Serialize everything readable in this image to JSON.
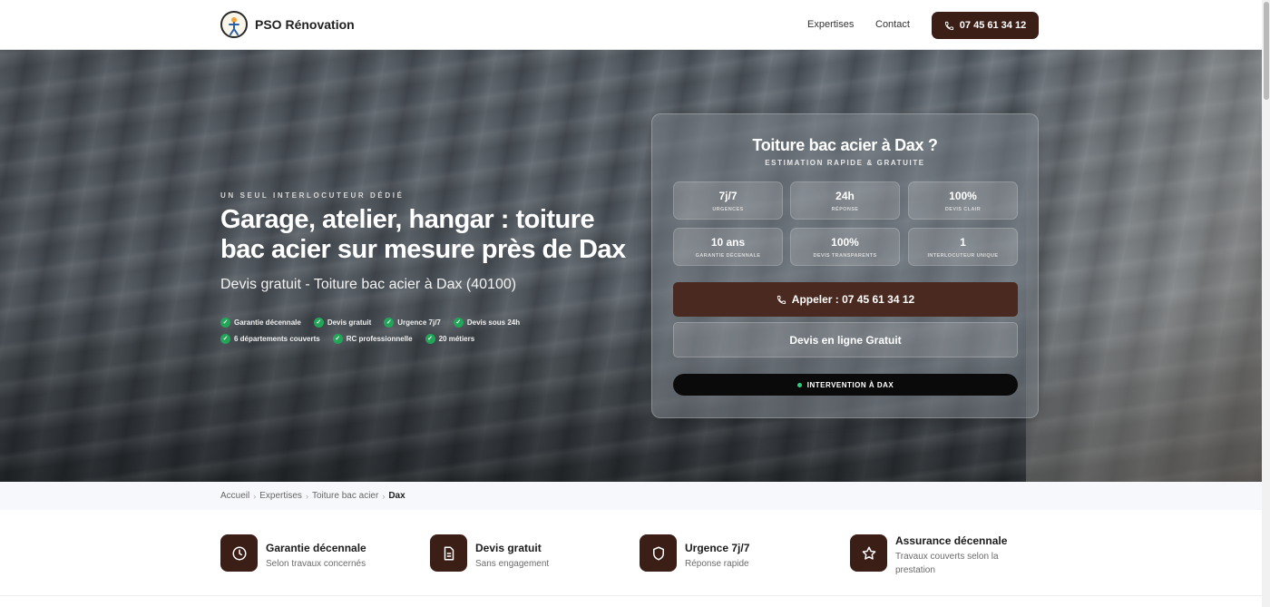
{
  "header": {
    "brand": "PSO Rénovation",
    "nav": [
      "Expertises",
      "Contact"
    ],
    "phone": "07 45 61 34 12"
  },
  "hero": {
    "eyebrow": "UN SEUL INTERLOCUTEUR DÉDIÉ",
    "title": "Garage, atelier, hangar : toiture bac acier sur mesure près de Dax",
    "subtitle": "Devis gratuit - Toiture bac acier à Dax (40100)",
    "chips_row1": [
      "Garantie décennale",
      "Devis gratuit",
      "Urgence 7j/7",
      "Devis sous 24h"
    ],
    "chips_row2": [
      "6 départements couverts",
      "RC professionnelle",
      "20 métiers"
    ]
  },
  "card": {
    "title": "Toiture bac acier à Dax ?",
    "subtitle": "ESTIMATION RAPIDE & GRATUITE",
    "stats": [
      {
        "value": "7j/7",
        "label": "URGENCES"
      },
      {
        "value": "24h",
        "label": "RÉPONSE"
      },
      {
        "value": "100%",
        "label": "DEVIS CLAIR"
      },
      {
        "value": "10 ans",
        "label": "GARANTIE DÉCENNALE"
      },
      {
        "value": "100%",
        "label": "DEVIS TRANSPARENTS"
      },
      {
        "value": "1",
        "label": "INTERLOCUTEUR UNIQUE"
      }
    ],
    "call_label": "Appeler : 07 45 61 34 12",
    "online_label": "Devis en ligne Gratuit",
    "location_label": "INTERVENTION À DAX"
  },
  "breadcrumb": [
    "Accueil",
    "Expertises",
    "Toiture bac acier",
    "Dax"
  ],
  "features": [
    {
      "icon": "clock-icon",
      "title": "Garantie décennale",
      "desc": "Selon travaux concernés"
    },
    {
      "icon": "document-icon",
      "title": "Devis gratuit",
      "desc": "Sans engagement"
    },
    {
      "icon": "shield-icon",
      "title": "Urgence 7j/7",
      "desc": "Réponse rapide"
    },
    {
      "icon": "star-icon",
      "title": "Assurance décennale",
      "desc": "Travaux couverts selon la prestation"
    }
  ],
  "colors": {
    "brand_brown": "#3b1e16",
    "check_green": "#22a559",
    "status_dot": "#26d07c"
  }
}
